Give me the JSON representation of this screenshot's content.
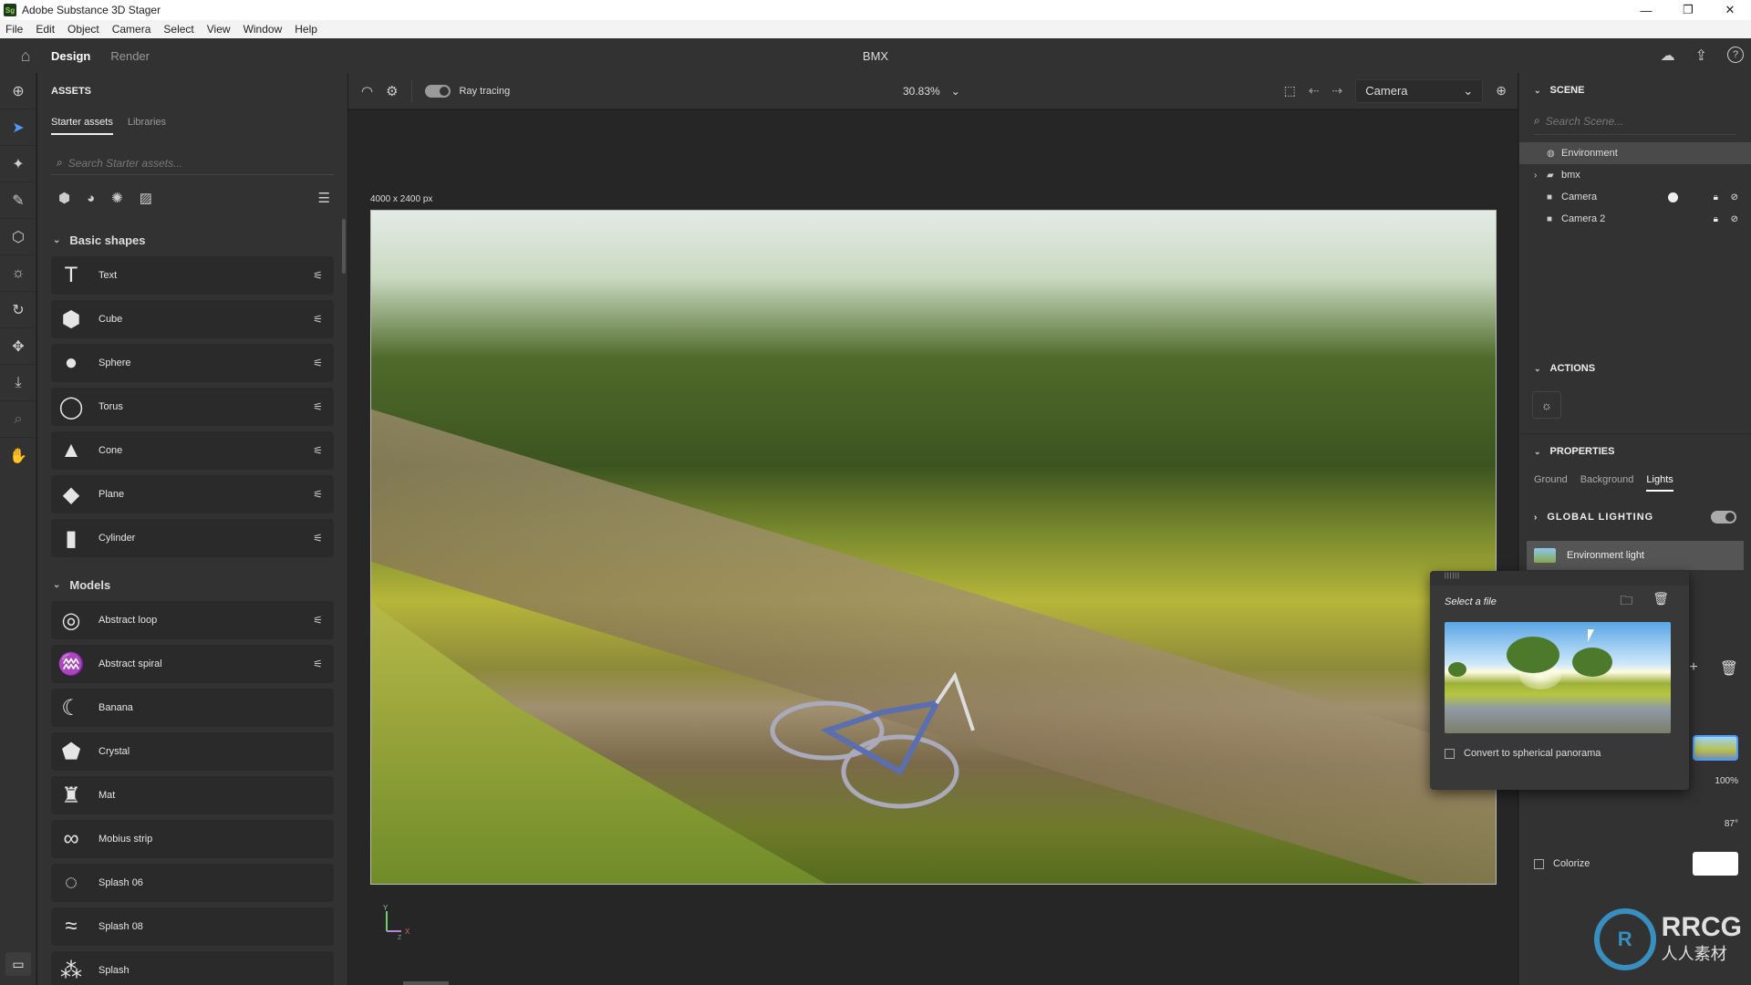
{
  "window": {
    "app_title": "Adobe Substance 3D Stager",
    "logo_text": "Sg",
    "controls": {
      "minimize": "—",
      "maximize": "❐",
      "close": "✕"
    }
  },
  "menu": [
    "File",
    "Edit",
    "Object",
    "Camera",
    "Select",
    "View",
    "Window",
    "Help"
  ],
  "appbar": {
    "home_icon": "⌂",
    "tabs": [
      {
        "label": "Design",
        "active": true
      },
      {
        "label": "Render",
        "active": false
      }
    ],
    "document_title": "BMX",
    "right_icons": {
      "cloud": "☁",
      "share": "⇪",
      "help": "?"
    }
  },
  "toolrail": {
    "tools": [
      {
        "name": "add-icon",
        "glyph": "⊕"
      },
      {
        "name": "select-icon",
        "glyph": "➤"
      },
      {
        "name": "magic-wand-icon",
        "glyph": "✦"
      },
      {
        "name": "eyedropper-icon",
        "glyph": "✎"
      },
      {
        "name": "cube-icon",
        "glyph": "⬡"
      },
      {
        "name": "light-icon",
        "glyph": "☼"
      },
      {
        "name": "orbit-icon",
        "glyph": "↻"
      },
      {
        "name": "move-icon",
        "glyph": "✥"
      },
      {
        "name": "drop-icon",
        "glyph": "⤓"
      },
      {
        "name": "zoom-icon",
        "glyph": "⌕"
      },
      {
        "name": "hand-icon",
        "glyph": "✋"
      }
    ],
    "bottom_icon": "▭"
  },
  "assets": {
    "title": "ASSETS",
    "tabs": [
      {
        "label": "Starter assets",
        "active": true
      },
      {
        "label": "Libraries",
        "active": false
      }
    ],
    "search_placeholder": "Search Starter assets...",
    "filters": {
      "models": "⬢",
      "materials": "◕",
      "lights": "✺",
      "images": "▨",
      "list_view": "☰"
    },
    "sections": [
      {
        "title": "Basic shapes",
        "items": [
          {
            "label": "Text",
            "thumb": "T",
            "options": true
          },
          {
            "label": "Cube",
            "thumb": "⬢",
            "options": true
          },
          {
            "label": "Sphere",
            "thumb": "●",
            "options": true
          },
          {
            "label": "Torus",
            "thumb": "◯",
            "options": true
          },
          {
            "label": "Cone",
            "thumb": "▲",
            "options": true
          },
          {
            "label": "Plane",
            "thumb": "◆",
            "options": true
          },
          {
            "label": "Cylinder",
            "thumb": "▮",
            "options": true
          }
        ]
      },
      {
        "title": "Models",
        "items": [
          {
            "label": "Abstract loop",
            "thumb": "◎",
            "options": true
          },
          {
            "label": "Abstract spiral",
            "thumb": "♒",
            "options": true
          },
          {
            "label": "Banana",
            "thumb": "☾",
            "options": false
          },
          {
            "label": "Crystal",
            "thumb": "⬟",
            "options": false
          },
          {
            "label": "Mat",
            "thumb": "♜",
            "options": false
          },
          {
            "label": "Mobius strip",
            "thumb": "∞",
            "options": false
          },
          {
            "label": "Splash 06",
            "thumb": "◌",
            "options": false
          },
          {
            "label": "Splash 08",
            "thumb": "≈",
            "options": false
          },
          {
            "label": "Splash",
            "thumb": "⁂",
            "options": false
          }
        ]
      }
    ]
  },
  "viewport_toolbar": {
    "ray_tracing_label": "Ray tracing",
    "ray_tracing_on": true,
    "zoom_value": "30.83%",
    "camera_select": "Camera"
  },
  "canvas": {
    "resolution": "4000 x 2400 px",
    "axes": {
      "y": "Y",
      "x": "X",
      "z": "Z"
    }
  },
  "scene": {
    "title": "SCENE",
    "search_placeholder": "Search Scene...",
    "tree": [
      {
        "label": "Environment",
        "icon": "🌐",
        "selected": true,
        "expandable": false,
        "dot": false,
        "lock": false,
        "hidden": false
      },
      {
        "label": "bmx",
        "icon": "▰",
        "selected": false,
        "expandable": true,
        "dot": false,
        "lock": false,
        "hidden": false
      },
      {
        "label": "Camera",
        "icon": "■◂",
        "selected": false,
        "expandable": false,
        "dot": true,
        "lock": true,
        "hidden": true
      },
      {
        "label": "Camera 2",
        "icon": "■◂",
        "selected": false,
        "expandable": false,
        "dot": false,
        "lock": true,
        "hidden": true
      }
    ]
  },
  "actions": {
    "title": "ACTIONS"
  },
  "properties": {
    "title": "PROPERTIES",
    "tabs": [
      {
        "label": "Ground",
        "active": false
      },
      {
        "label": "Background",
        "active": false
      },
      {
        "label": "Lights",
        "active": true
      }
    ],
    "global_lighting_label": "GLOBAL LIGHTING",
    "global_lighting_on": true,
    "environment_light_label": "Environment light",
    "intensity": "100%",
    "rotation": "87°",
    "colorize_label": "Colorize",
    "colorize_checked": false,
    "colorize_color": "#ffffff"
  },
  "file_popup": {
    "grip": "||||||",
    "title": "Select a file",
    "convert_label": "Convert to spherical panorama",
    "convert_checked": false
  },
  "watermark": {
    "brand": "RRCG",
    "sub": "人人素材"
  }
}
